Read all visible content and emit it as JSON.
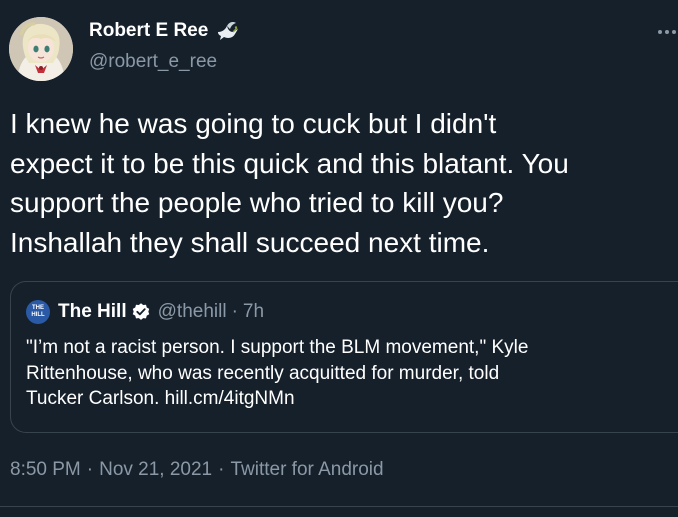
{
  "author": {
    "display_name": "Robert E Ree",
    "handle": "@robert_e_ree",
    "avatar_icon": "anime-girl-avatar",
    "badge_icon": "dove-emoji"
  },
  "tweet": {
    "text_lines": [
      "I knew he was going to cuck but I didn't",
      "expect it to be this quick and this blatant. You",
      "support the people who tried to kill you?",
      "Inshallah they shall succeed next time."
    ]
  },
  "quoted_tweet": {
    "logo_text": "THE HILL",
    "display_name": "The Hill",
    "verified_icon": "verified-badge",
    "handle": "@thehill",
    "separator": "·",
    "time": "7h",
    "text_lines": [
      "\"I’m not a racist person. I support the BLM movement,\" Kyle",
      "Rittenhouse, who was recently acquitted for murder, told",
      "Tucker Carlson. hill.cm/4itgNMn"
    ]
  },
  "meta": {
    "time": "8:50 PM",
    "separator": "·",
    "date": "Nov 21, 2021",
    "source": "Twitter for Android"
  },
  "colors": {
    "background": "#15202b",
    "text": "#ffffff",
    "secondary_text": "#8b98a5",
    "border": "#38444d",
    "verified": "#ffffff"
  }
}
